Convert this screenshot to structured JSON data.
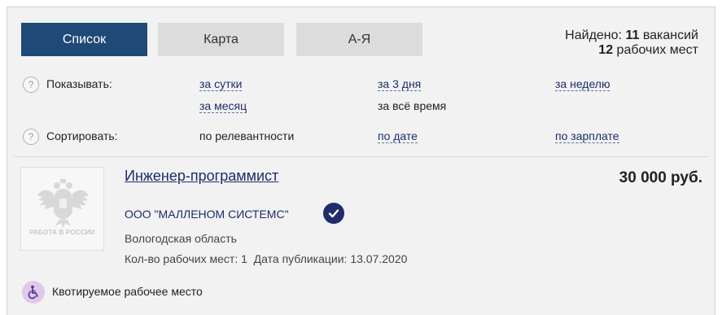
{
  "tabs": [
    {
      "label": "Список",
      "active": true
    },
    {
      "label": "Карта",
      "active": false
    },
    {
      "label": "А-Я",
      "active": false
    }
  ],
  "found": {
    "prefix": "Найдено:",
    "vacancies_count": "11",
    "vacancies_label": "вакансий",
    "places_count": "12",
    "places_label": "рабочих мест"
  },
  "filters": {
    "show_label": "Показывать:",
    "show_options": [
      "за сутки",
      "за 3 дня",
      "за неделю",
      "за месяц",
      "за всё время"
    ],
    "show_selected": "за всё время",
    "sort_label": "Сортировать:",
    "sort_options": [
      "по релевантности",
      "по дате",
      "по зарплате"
    ],
    "sort_selected": "по релевантности",
    "help_glyph": "?"
  },
  "vacancy": {
    "logo_text": "РАБОТА В РОССИИ",
    "title": "Инженер-программист",
    "salary": "30 000 руб.",
    "company": "ООО \"МАЛЛЕНОМ СИСТЕМС\"",
    "region": "Вологодская область",
    "workplaces": "Кол-во рабочих мест: 1",
    "published": "Дата публикации: 13.07.2020",
    "quota_label": "Квотируемое рабочее место"
  },
  "colors": {
    "tab_active": "#1f4a78",
    "tab_inactive": "#dcdcdc",
    "link": "#1a2d6b",
    "verified_badge": "#1f2d6a",
    "quota_badge": "#e2c7ed",
    "panel_bg": "#f2f2f2"
  },
  "icons": {
    "help": "question-circle-icon",
    "verified": "verified-check-icon",
    "quota": "wheelchair-icon",
    "logo": "double-headed-eagle-emblem"
  }
}
